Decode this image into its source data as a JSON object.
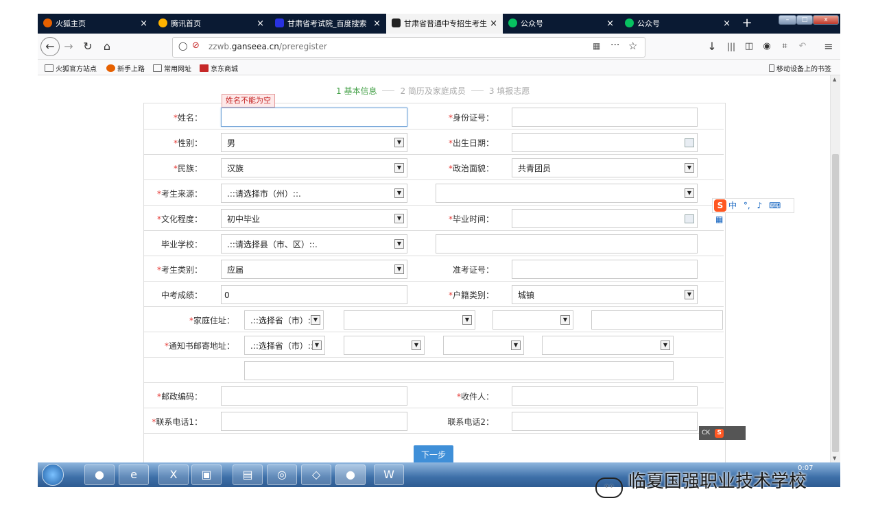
{
  "tabs": [
    {
      "label": "火狐主页",
      "icon": "firefox-icon",
      "color": "#e66000"
    },
    {
      "label": "腾讯首页",
      "icon": "tencent-icon",
      "color": "#ffb300"
    },
    {
      "label": "甘肃省考试院_百度搜索",
      "icon": "baidu-icon",
      "color": "#2932e1"
    },
    {
      "label": "甘肃省普通中专招生考生",
      "icon": "site-icon",
      "color": "#222222"
    },
    {
      "label": "公众号",
      "icon": "wechat-mp-icon",
      "color": "#07c160"
    },
    {
      "label": "公众号",
      "icon": "wechat-mp-icon",
      "color": "#07c160"
    }
  ],
  "tab_close_glyph": "×",
  "new_tab_glyph": "+",
  "address": {
    "prefix": "zzwb.",
    "domain": "ganseea.cn",
    "path": "/preregister"
  },
  "bookmarks": [
    "火狐官方站点",
    "新手上路",
    "常用网址",
    "京东商城"
  ],
  "mobile_bookmarks": "移动设备上的书签",
  "steps": [
    "1 基本信息",
    "2 简历及家庭成员",
    "3 填报志愿"
  ],
  "tooltip": "姓名不能为空",
  "form": {
    "name_label": "姓名：",
    "id_label": "身份证号：",
    "gender_label": "性别：",
    "gender_value": "男",
    "birth_label": "出生日期：",
    "ethnic_label": "民族：",
    "ethnic_value": "汉族",
    "political_label": "政治面貌：",
    "political_value": "共青团员",
    "source_label": "考生来源：",
    "source_value": ".::请选择市（州）::.",
    "education_label": "文化程度：",
    "education_value": "初中毕业",
    "gradtime_label": "毕业时间：",
    "school_label": "毕业学校：",
    "school_value": ".::请选择县（市、区）::.",
    "category_label": "考生类别：",
    "category_value": "应届",
    "admission_label": "准考证号：",
    "score_label": "中考成绩：",
    "score_value": "0",
    "household_label": "户籍类别：",
    "household_value": "城镇",
    "home_label": "家庭住址：",
    "home_province": ".::选择省（市）::.",
    "mail_label": "通知书邮寄地址：",
    "mail_province": ".::选择省（市）::.",
    "zip_label": "邮政编码：",
    "receiver_label": "收件人：",
    "phone1_label": "联系电话1：",
    "phone2_label": "联系电话2：",
    "required_mark": "*"
  },
  "next_button": "下一步",
  "ime_text": "中",
  "ime_logo": "S",
  "ck_text": "CK",
  "clock": "0:07",
  "watermark": "临夏国强职业技术学校",
  "colors": {
    "accent": "#3f8fd8",
    "required": "#e53935",
    "step_active": "#43a047",
    "tabstrip": "#0a1a33"
  }
}
